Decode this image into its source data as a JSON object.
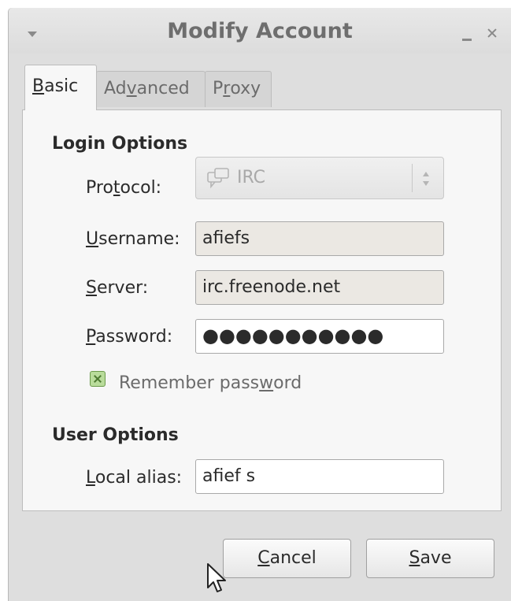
{
  "window": {
    "title": "Modify Account"
  },
  "tabs": [
    {
      "pre": "",
      "key": "B",
      "post": "asic",
      "active": true
    },
    {
      "pre": "Ad",
      "key": "v",
      "post": "anced",
      "active": false
    },
    {
      "pre": "P",
      "key": "r",
      "post": "oxy",
      "active": false
    }
  ],
  "login_options": {
    "heading": "Login Options",
    "protocol": {
      "label_pre": "Pro",
      "label_key": "t",
      "label_post": "ocol:",
      "value": "IRC"
    },
    "username": {
      "label_pre": "",
      "label_key": "U",
      "label_post": "sername:",
      "value": "afiefs"
    },
    "server": {
      "label_pre": "",
      "label_key": "S",
      "label_post": "erver:",
      "value": "irc.freenode.net"
    },
    "password": {
      "label_pre": "",
      "label_key": "P",
      "label_post": "assword:",
      "value": "●●●●●●●●●●●"
    },
    "remember": {
      "label_pre": "Remember pass",
      "label_key": "w",
      "label_post": "ord",
      "checked": true
    }
  },
  "user_options": {
    "heading": "User Options",
    "local_alias": {
      "label_pre": "",
      "label_key": "L",
      "label_post": "ocal alias:",
      "value": "afief s"
    }
  },
  "buttons": {
    "cancel": {
      "pre": "",
      "key": "C",
      "post": "ancel"
    },
    "save": {
      "pre": "",
      "key": "S",
      "post": "ave"
    }
  },
  "colors": {
    "window_bg": "#dedede",
    "panel_bg": "#f7f7f7",
    "checkbox_green": "#b9dc9b"
  }
}
